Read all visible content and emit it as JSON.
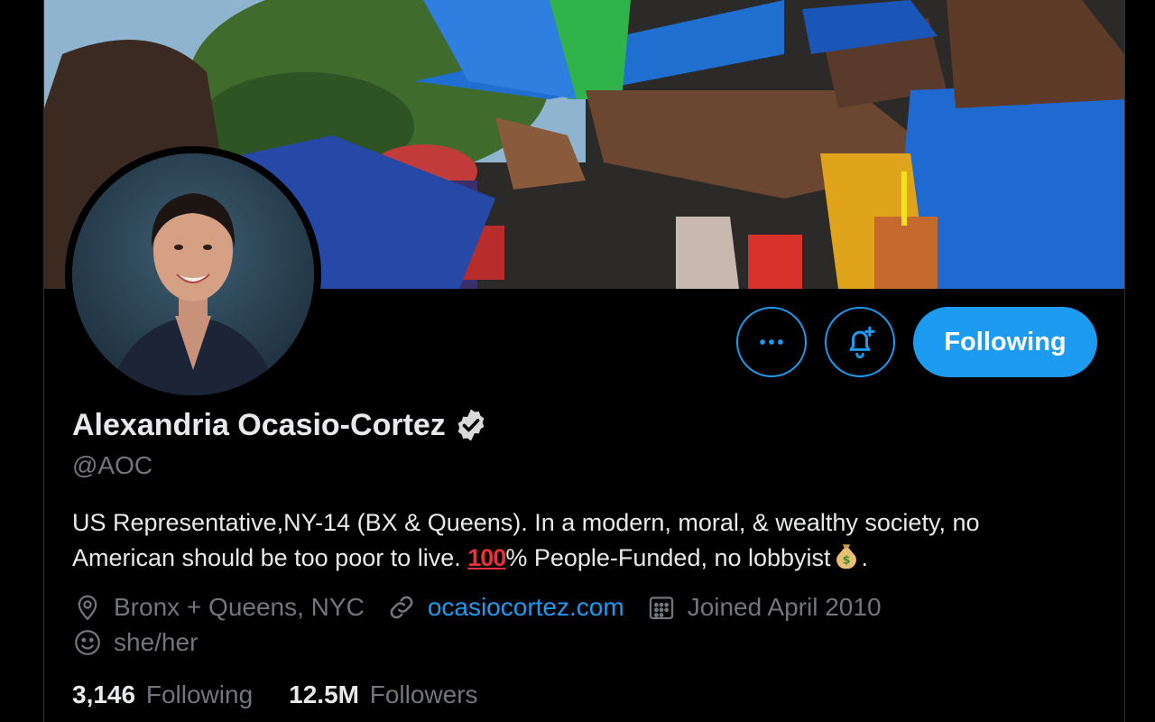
{
  "profile": {
    "name": "Alexandria Ocasio-Cortez",
    "handle": "@AOC",
    "bio": {
      "part1": "US Representative,NY-14 (BX & Queens). In a modern, moral, & wealthy society, no American should be too poor to live. ",
      "hundred": "100",
      "part2": "% People-Funded, no lobbyist",
      "part3": "."
    },
    "location": "Bronx + Queens, NYC",
    "website": "ocasiocortez.com",
    "joined": "Joined April 2010",
    "pronouns": "she/her"
  },
  "actions": {
    "more_icon": "more-horizontal-icon",
    "notify_icon": "bell-plus-icon",
    "follow_label": "Following"
  },
  "stats": {
    "following_count": "3,146",
    "following_label": "Following",
    "followers_count": "12.5M",
    "followers_label": "Followers"
  },
  "colors": {
    "accent": "#1d9bf0",
    "background": "#000000",
    "secondary_text": "#71767b"
  }
}
